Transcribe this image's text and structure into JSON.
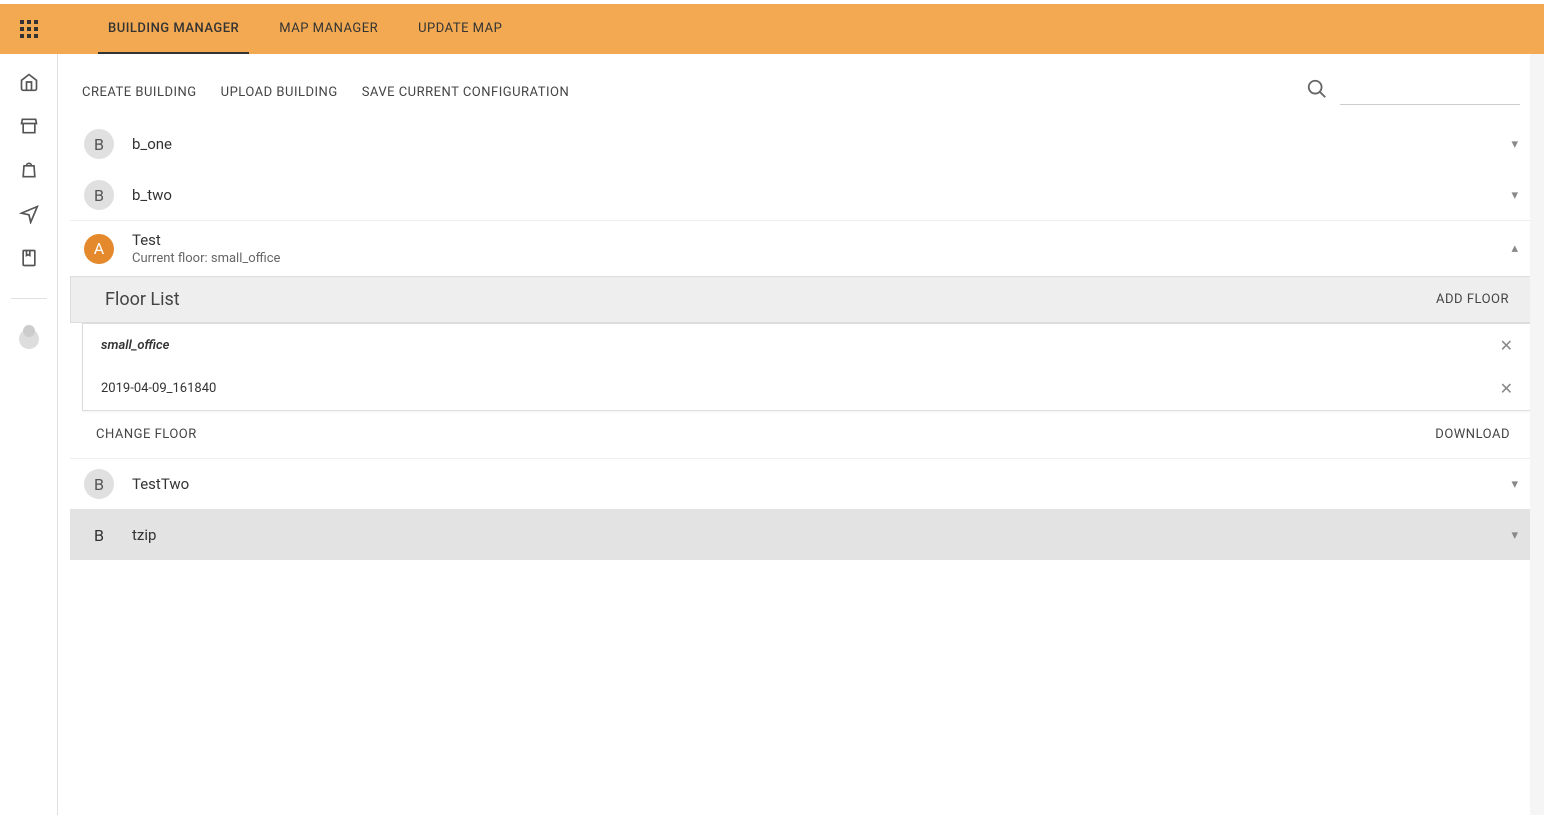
{
  "tabs": {
    "building_manager": "BUILDING MANAGER",
    "map_manager": "MAP MANAGER",
    "update_map": "UPDATE MAP"
  },
  "actions": {
    "create": "CREATE BUILDING",
    "upload": "UPLOAD BUILDING",
    "save": "SAVE CURRENT CONFIGURATION"
  },
  "search": {
    "placeholder": ""
  },
  "buildings": {
    "b_one": {
      "badge": "B",
      "name": "b_one"
    },
    "b_two": {
      "badge": "B",
      "name": "b_two"
    },
    "test": {
      "badge": "A",
      "name": "Test",
      "subtitle_prefix": "Current floor: ",
      "current_floor": "small_office"
    },
    "testtwo": {
      "badge": "B",
      "name": "TestTwo"
    },
    "tzip": {
      "badge": "B",
      "name": "tzip"
    }
  },
  "floor_panel": {
    "title": "Floor List",
    "add": "ADD FLOOR",
    "change": "CHANGE FLOOR",
    "download": "DOWNLOAD",
    "floors": {
      "small_office": "small_office",
      "ts": "2019-04-09_161840"
    }
  },
  "icons": {
    "chev_down": "▾",
    "chev_up": "▴",
    "close": "✕"
  }
}
